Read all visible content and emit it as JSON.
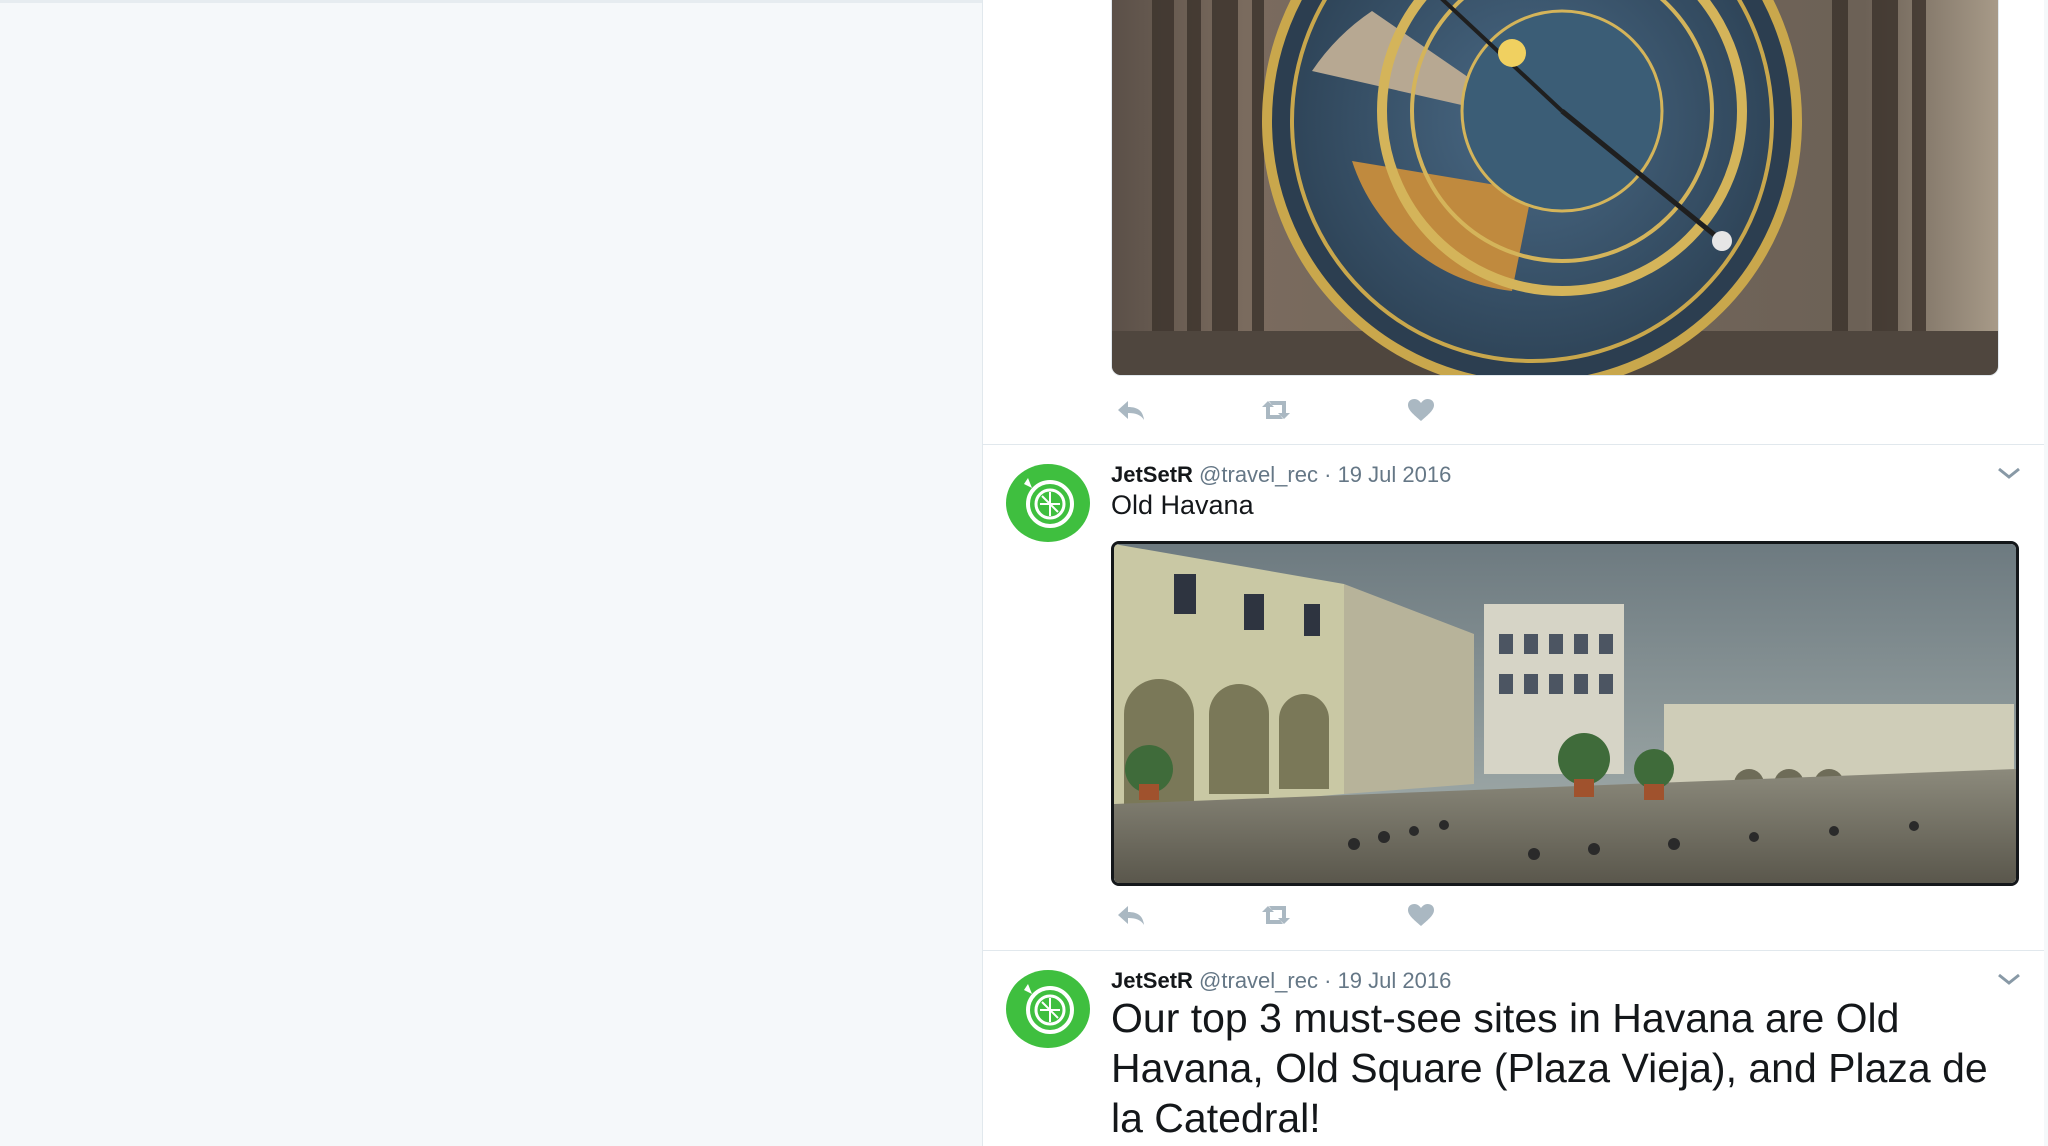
{
  "timeline": {
    "tweets": [
      {
        "media": {
          "alt": "Astronomical clock"
        },
        "actions": {
          "reply": "reply-icon",
          "retweet": "retweet-icon",
          "like": "heart-icon"
        }
      },
      {
        "author_name": "JetSetR",
        "handle": "@travel_rec",
        "separator": "·",
        "date": "19 Jul 2016",
        "text": "Old Havana",
        "media": {
          "alt": "Old Havana plaza"
        },
        "actions": {
          "reply": "reply-icon",
          "retweet": "retweet-icon",
          "like": "heart-icon"
        }
      },
      {
        "author_name": "JetSetR",
        "handle": "@travel_rec",
        "separator": "·",
        "date": "19 Jul 2016",
        "text": "Our top 3 must-see sites in Havana are Old Havana, Old Square (Plaza Vieja), and Plaza de la Catedral!"
      }
    ]
  },
  "colors": {
    "accent": "#f5a623",
    "avatar_green": "#3fbf3f",
    "text_primary": "#14171a",
    "text_secondary": "#657786",
    "icon_gray": "#aab8c2"
  }
}
